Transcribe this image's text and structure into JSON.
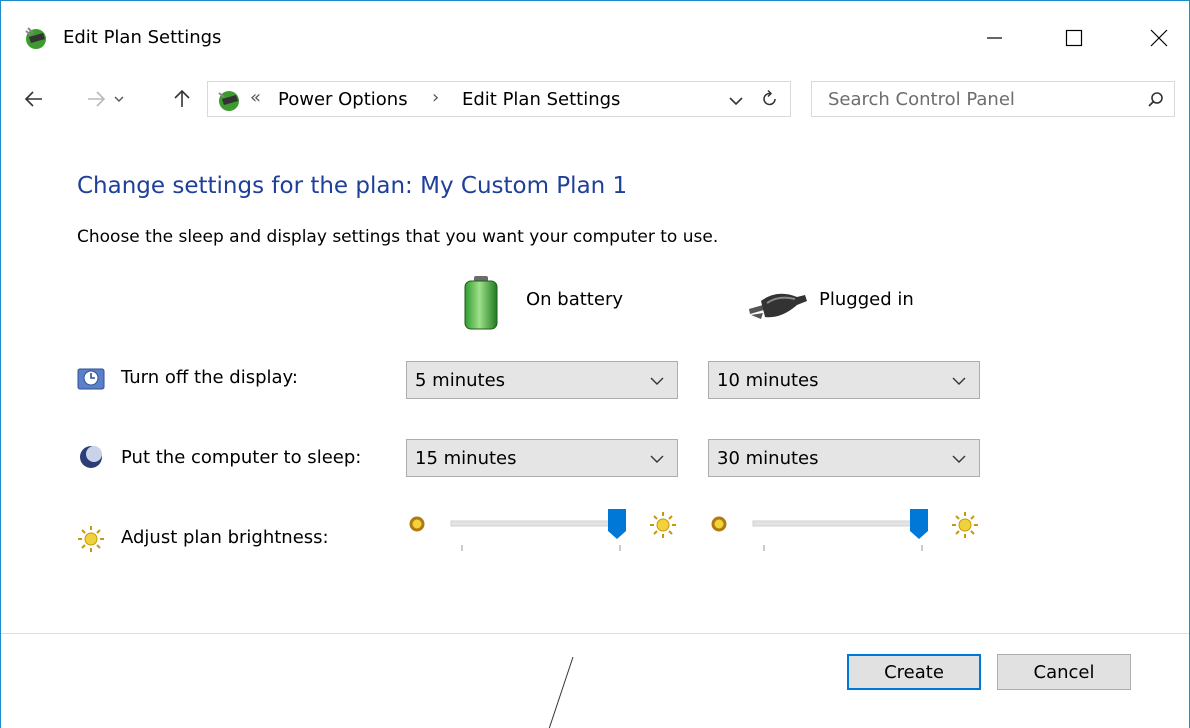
{
  "window": {
    "title": "Edit Plan Settings"
  },
  "nav": {
    "breadcrumb_prefix": "«",
    "breadcrumb": [
      "Power Options",
      "Edit Plan Settings"
    ],
    "breadcrumb_separator": "›",
    "search_placeholder": "Search Control Panel"
  },
  "content": {
    "heading": "Change settings for the plan: My Custom Plan 1",
    "subtext": "Choose the sleep and display settings that you want your computer to use.",
    "columns": {
      "battery": "On battery",
      "plugged": "Plugged in"
    },
    "rows": {
      "display": {
        "label": "Turn off the display:",
        "battery": "5 minutes",
        "plugged": "10 minutes"
      },
      "sleep": {
        "label": "Put the computer to sleep:",
        "battery": "15 minutes",
        "plugged": "30 minutes"
      },
      "brightness": {
        "label": "Adjust plan brightness:",
        "battery_level": 1.0,
        "plugged_level": 1.0
      }
    }
  },
  "buttons": {
    "create": "Create",
    "cancel": "Cancel"
  },
  "colors": {
    "accent": "#0078d7",
    "heading": "#1e3f9a",
    "window_border": "#1b8cc8"
  }
}
